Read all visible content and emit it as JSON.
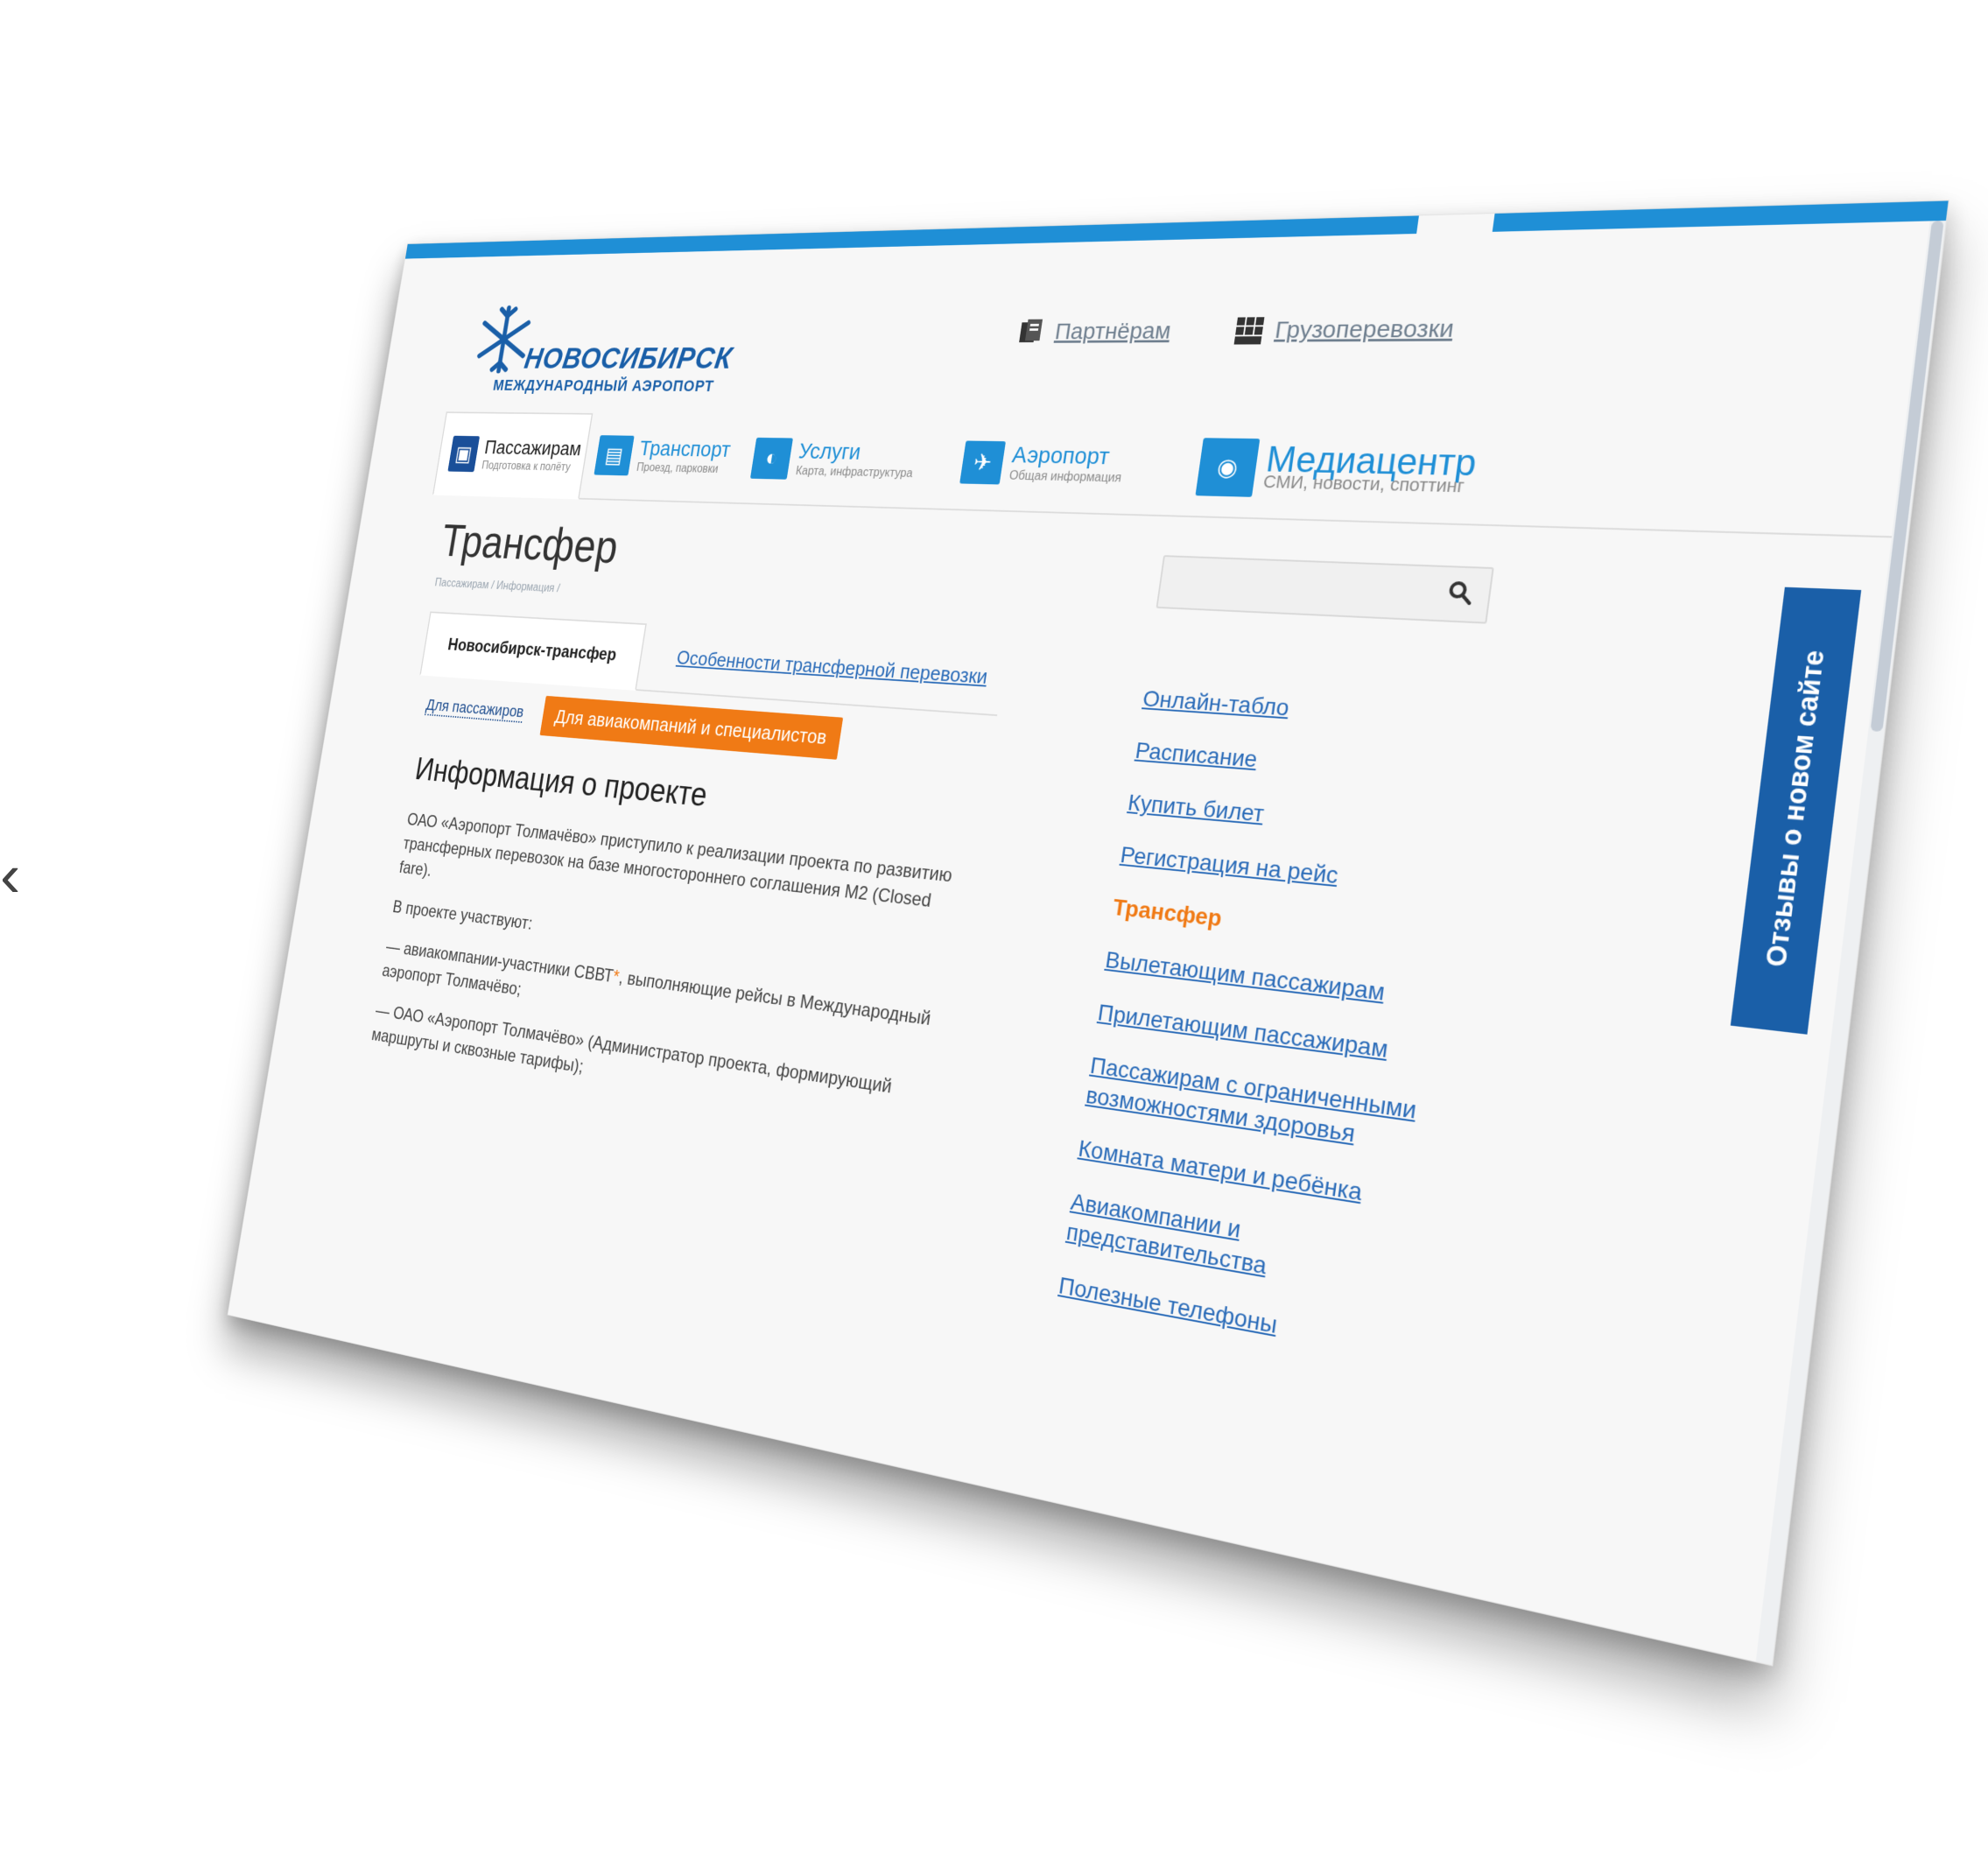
{
  "logo": {
    "city": "НОВОСИБИРСК",
    "subtitle": "МЕЖДУНАРОДНЫЙ АЭРОПОРТ"
  },
  "top_links": {
    "partners": "Партнёрам",
    "cargo": "Грузоперевозки"
  },
  "nav": [
    {
      "title": "Пассажирам",
      "sub": "Подготовка к полёту",
      "icon": "luggage-icon"
    },
    {
      "title": "Транспорт",
      "sub": "Проезд, парковки",
      "icon": "bus-icon"
    },
    {
      "title": "Услуги",
      "sub": "Карта, инфраструктура",
      "icon": "services-icon"
    },
    {
      "title": "Аэропорт",
      "sub": "Общая информация",
      "icon": "plane-icon"
    },
    {
      "title": "Медиацентр",
      "sub": "СМИ, новости, споттинг",
      "icon": "camera-icon"
    }
  ],
  "page": {
    "title": "Трансфер",
    "breadcrumbs": "Пассажирам / Информация /"
  },
  "subtabs": {
    "active": "Новосибирск-трансфер",
    "other": "Особенности трансферной перевозки"
  },
  "audience": {
    "passengers": "Для пассажиров",
    "airlines": "Для авиакомпаний и специалистов"
  },
  "content": {
    "heading": "Информация о проекте",
    "p1": "ОАО «Аэропорт Толмачёво» приступило к реализации проекта по развитию трансферных перевозок на базе многостороннего соглашения М2 (Closed fare).",
    "p2": "В проекте участвуют:",
    "li1_a": "— авиакомпании-участники СВВТ",
    "li1_star": "*",
    "li1_b": ", выполняющие рейсы в Международный аэропорт Толмачёво;",
    "li2": "— ОАО «Аэропорт Толмачёво» (Администратор проекта, формирующий маршруты и сквозные тарифы);"
  },
  "sidemenu": [
    "Онлайн-табло",
    "Расписание",
    "Купить билет",
    "Регистрация на рейс",
    "Трансфер",
    "Вылетающим пассажирам",
    "Прилетающим пассажирам",
    "Пассажирам с ограниченными возможностями здоровья",
    "Комната матери и ребёнка",
    "Авиакомпании и представительства",
    "Полезные телефоны"
  ],
  "sidemenu_current_index": 4,
  "feedback": "Отзывы о новом сайте",
  "edge_glyph": "‹",
  "colors": {
    "accent": "#1f8fd6",
    "brand": "#1a5fa8",
    "highlight": "#f07a15"
  }
}
